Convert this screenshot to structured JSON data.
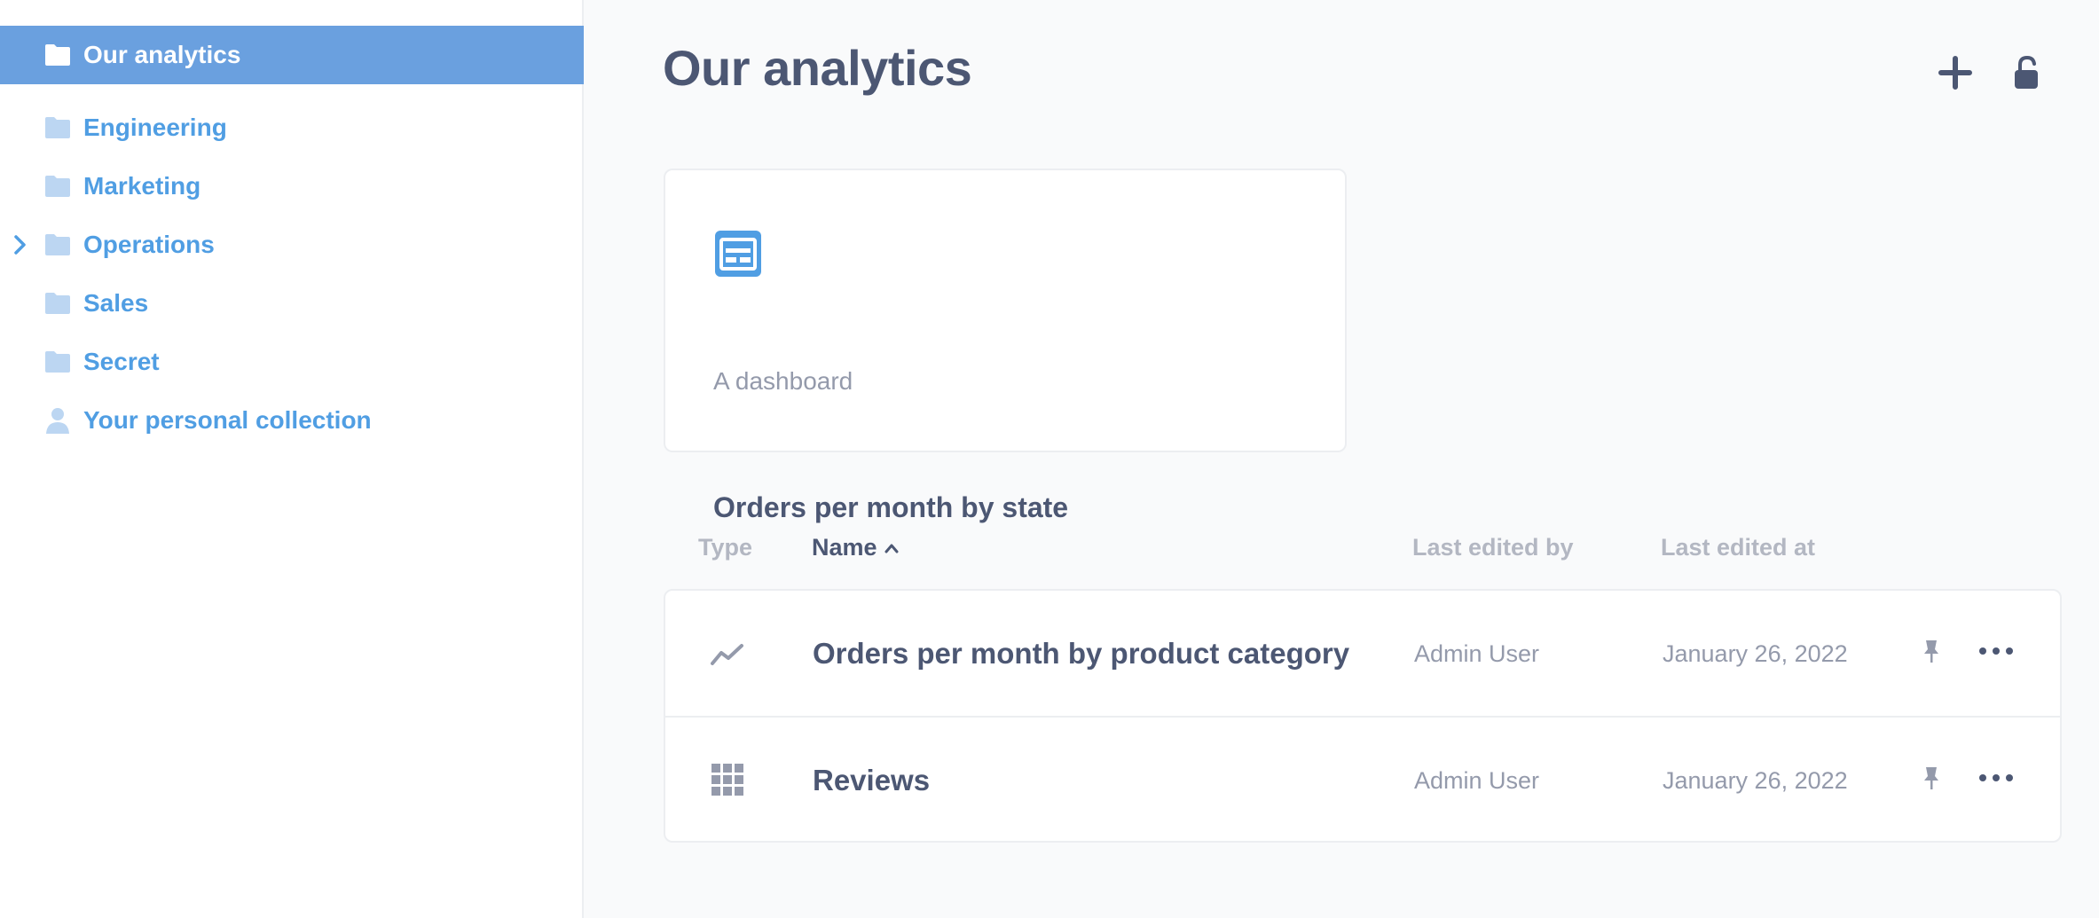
{
  "sidebar": {
    "items": [
      {
        "label": "Our analytics",
        "icon": "folder-icon",
        "active": true
      },
      {
        "label": "Engineering",
        "icon": "folder-icon"
      },
      {
        "label": "Marketing",
        "icon": "folder-icon"
      },
      {
        "label": "Operations",
        "icon": "folder-icon",
        "expandable": true
      },
      {
        "label": "Sales",
        "icon": "folder-icon"
      },
      {
        "label": "Secret",
        "icon": "folder-icon"
      },
      {
        "label": "Your personal collection",
        "icon": "person-icon"
      }
    ]
  },
  "header": {
    "title": "Our analytics",
    "new_icon": "plus-icon",
    "permissions_icon": "lock-icon"
  },
  "pinned": {
    "icon": "dashboard-icon",
    "title": "Orders per month by state",
    "description": "A dashboard"
  },
  "table": {
    "columns": {
      "type": "Type",
      "name": "Name",
      "last_edited_by": "Last edited by",
      "last_edited_at": "Last edited at"
    },
    "sort_icon": "chevron-up-icon",
    "rows": [
      {
        "type_icon": "line-chart-icon",
        "name": "Orders per month by product category",
        "editor": "Admin User",
        "edited": "January 26, 2022"
      },
      {
        "type_icon": "table-grid-icon",
        "name": "Reviews",
        "editor": "Admin User",
        "edited": "January 26, 2022"
      }
    ]
  },
  "colors": {
    "brand": "#509ee3",
    "active_bg": "#6aa0df",
    "text_dark": "#4c5773",
    "text_light": "#949aab",
    "folder_light": "#bcd6f2"
  }
}
